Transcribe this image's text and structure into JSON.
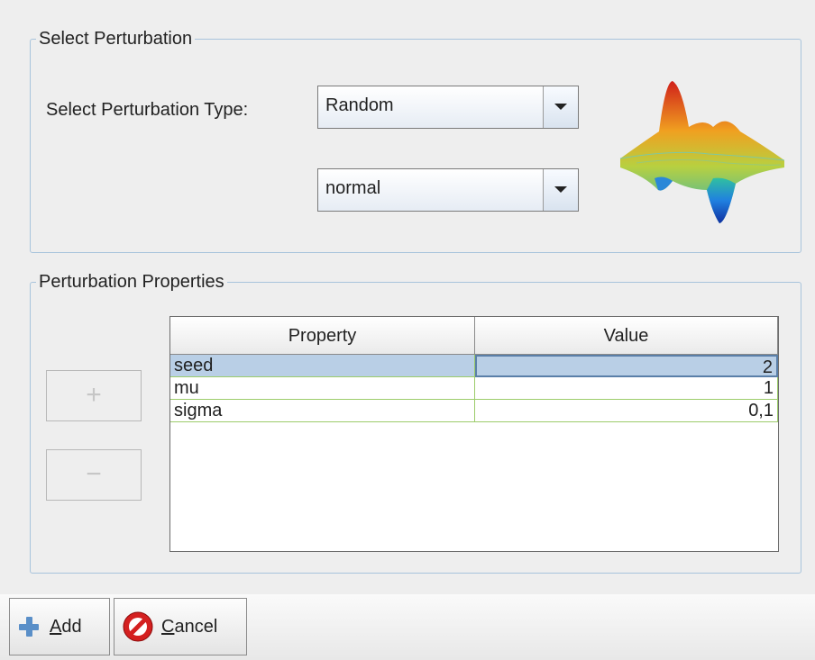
{
  "select_group": {
    "title": "Select Perturbation",
    "type_label": "Select Perturbation Type:",
    "type_value": "Random",
    "dist_value": "normal"
  },
  "props_group": {
    "title": "Perturbation Properties",
    "add_symbol": "+",
    "remove_symbol": "−",
    "columns": [
      "Property",
      "Value"
    ],
    "rows": [
      {
        "property": "seed",
        "value": "2"
      },
      {
        "property": "mu",
        "value": "1"
      },
      {
        "property": "sigma",
        "value": "0,1"
      }
    ]
  },
  "buttons": {
    "add_mnemonic": "A",
    "add_rest": "dd",
    "cancel_mnemonic": "C",
    "cancel_rest": "ancel"
  },
  "colors": {
    "accent_border": "#a8c4dc",
    "selection": "#b9cfe6",
    "grid": "#9ccc6a"
  }
}
